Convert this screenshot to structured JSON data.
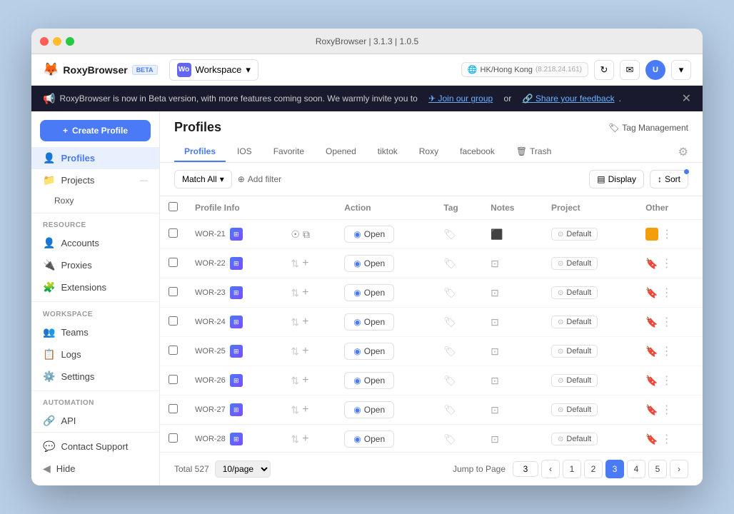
{
  "window": {
    "title": "RoxyBrowser | 3.1.3 | 1.0.5",
    "dots": [
      "red",
      "yellow",
      "green"
    ]
  },
  "header": {
    "logo_text": "RoxyBrowser",
    "beta_label": "BETA",
    "workspace_label": "Workspace",
    "workspace_initials": "Wo",
    "location": "HK/Hong Kong",
    "location_ip": "(8.218.24.161)",
    "create_profile_label": "Create Profile"
  },
  "banner": {
    "text": "RoxyBrowser is now in Beta version, with more features coming soon. We warmly invite you to",
    "link1_text": "Join our group",
    "or_text": "or",
    "link2_text": "Share your feedback"
  },
  "sidebar": {
    "create_profile_label": "✦ Create Profile",
    "nav_items": [
      {
        "id": "profiles",
        "label": "Profiles",
        "icon": "👤",
        "active": true
      },
      {
        "id": "projects",
        "label": "Projects",
        "icon": "📁",
        "active": false
      }
    ],
    "sub_items": [
      {
        "id": "roxy",
        "label": "Roxy"
      }
    ],
    "resource_label": "Resource",
    "resource_items": [
      {
        "id": "accounts",
        "label": "Accounts",
        "icon": "👤"
      },
      {
        "id": "proxies",
        "label": "Proxies",
        "icon": "🔌"
      },
      {
        "id": "extensions",
        "label": "Extensions",
        "icon": "🧩"
      }
    ],
    "workspace_label": "Workspace",
    "workspace_items": [
      {
        "id": "teams",
        "label": "Teams",
        "icon": "👥"
      },
      {
        "id": "logs",
        "label": "Logs",
        "icon": "📋"
      },
      {
        "id": "settings",
        "label": "Settings",
        "icon": "⚙️"
      }
    ],
    "automation_label": "Automation",
    "automation_items": [
      {
        "id": "api",
        "label": "API",
        "icon": "🔗"
      }
    ],
    "bottom_items": [
      {
        "id": "contact-support",
        "label": "Contact Support",
        "icon": "💬"
      },
      {
        "id": "hide",
        "label": "Hide",
        "icon": "◀"
      }
    ]
  },
  "profiles_page": {
    "title": "Profiles",
    "tag_management_label": "Tag Management",
    "tabs": [
      {
        "id": "profiles",
        "label": "Profiles",
        "active": true
      },
      {
        "id": "ios",
        "label": "IOS",
        "active": false
      },
      {
        "id": "favorite",
        "label": "Favorite",
        "active": false
      },
      {
        "id": "opened",
        "label": "Opened",
        "active": false
      },
      {
        "id": "tiktok",
        "label": "tiktok",
        "active": false
      },
      {
        "id": "roxy",
        "label": "Roxy",
        "active": false
      },
      {
        "id": "facebook",
        "label": "facebook",
        "active": false
      },
      {
        "id": "trash",
        "label": "Trash",
        "active": false,
        "has_icon": true
      }
    ],
    "match_all_label": "Match All",
    "add_filter_label": "Add filter",
    "display_label": "Display",
    "sort_label": "Sort",
    "table": {
      "columns": [
        "",
        "Profile Info",
        "",
        "Action",
        "Tag",
        "Notes",
        "Project",
        "Other"
      ],
      "rows": [
        {
          "id": "WOR-21",
          "has_action_icons": true,
          "has_note": true,
          "note_filled": true,
          "has_yellow_icon": true,
          "project": "Default",
          "other_has_item": true,
          "other_icon": "yellow"
        },
        {
          "id": "WOR-22",
          "has_action_icons": false,
          "has_note": true,
          "note_filled": false,
          "project": "Default",
          "other_has_item": false
        },
        {
          "id": "WOR-23",
          "has_action_icons": false,
          "has_note": true,
          "note_filled": false,
          "project": "Default",
          "other_has_item": false
        },
        {
          "id": "WOR-24",
          "has_action_icons": false,
          "has_note": true,
          "note_filled": false,
          "project": "Default",
          "other_has_item": false
        },
        {
          "id": "WOR-25",
          "has_action_icons": false,
          "has_note": true,
          "note_filled": false,
          "project": "Default",
          "other_has_item": false
        },
        {
          "id": "WOR-26",
          "has_action_icons": false,
          "has_note": true,
          "note_filled": false,
          "project": "Default",
          "other_has_item": false
        },
        {
          "id": "WOR-27",
          "has_action_icons": false,
          "has_note": true,
          "note_filled": false,
          "project": "Default",
          "other_has_item": false
        },
        {
          "id": "WOR-28",
          "has_action_icons": false,
          "has_note": true,
          "note_filled": false,
          "project": "Default",
          "other_has_item": false
        }
      ]
    },
    "pagination": {
      "total_text": "Total 527",
      "per_page": "10/page",
      "jump_label": "Jump to Page",
      "current_page": 3,
      "pages": [
        1,
        2,
        3,
        4,
        5
      ],
      "has_prev": true,
      "has_next": true
    }
  }
}
